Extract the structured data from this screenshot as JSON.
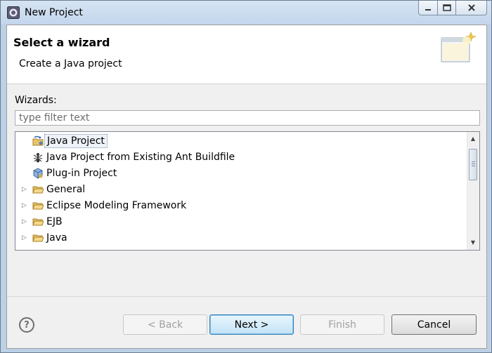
{
  "window": {
    "title": "New Project"
  },
  "header": {
    "title": "Select a wizard",
    "description": "Create a Java project"
  },
  "wizards": {
    "label": "Wizards:",
    "filter_placeholder": "type filter text",
    "items": [
      {
        "label": "Java Project",
        "icon": "java-project-icon",
        "expandable": false,
        "selected": true
      },
      {
        "label": "Java Project from Existing Ant Buildfile",
        "icon": "ant-icon",
        "expandable": false,
        "selected": false
      },
      {
        "label": "Plug-in Project",
        "icon": "plugin-project-icon",
        "expandable": false,
        "selected": false
      },
      {
        "label": "General",
        "icon": "folder-icon",
        "expandable": true,
        "selected": false
      },
      {
        "label": "Eclipse Modeling Framework",
        "icon": "folder-icon",
        "expandable": true,
        "selected": false
      },
      {
        "label": "EJB",
        "icon": "folder-icon",
        "expandable": true,
        "selected": false
      },
      {
        "label": "Java",
        "icon": "folder-icon",
        "expandable": true,
        "selected": false
      }
    ]
  },
  "buttons": {
    "help": "?",
    "back": "< Back",
    "next": "Next >",
    "finish": "Finish",
    "cancel": "Cancel"
  },
  "colors": {
    "title_bar": "#c3d6ec",
    "default_button": "#c2e3f6",
    "folder": "#e9c468"
  }
}
